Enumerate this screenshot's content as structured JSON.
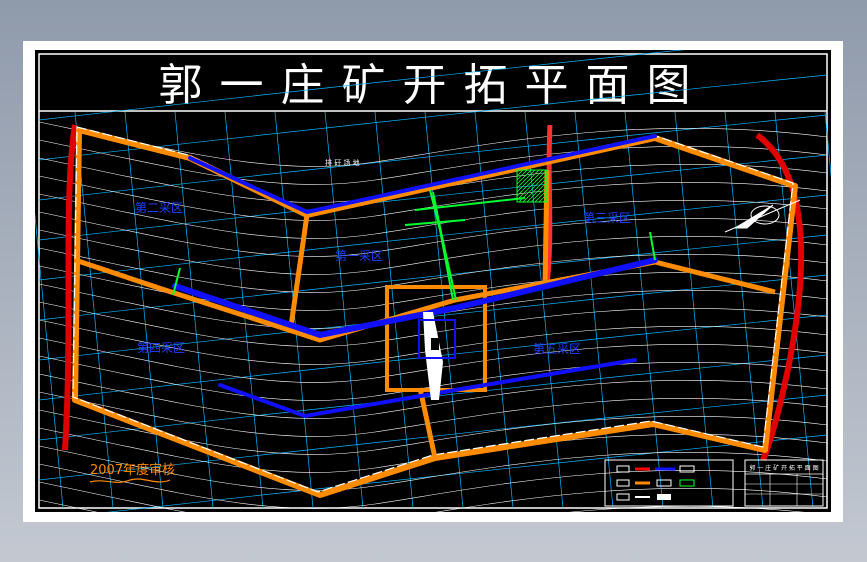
{
  "title": "郭一庄矿开拓平面图",
  "zones": {
    "zone1": "第一采区",
    "zone2": "第二采区",
    "zone3": "第三采区",
    "zone4": "第四采区",
    "zone5": "第五采区"
  },
  "road_label": "排 矸 场 地",
  "signature_label": "2007年度审核",
  "title_block": {
    "header": "郭 一 庄 矿 开 拓 平 面 图"
  },
  "colors": {
    "background": "#000000",
    "boundary": "#ff8c00",
    "roadway": "#1010ff",
    "fault": "#ff0000",
    "contour": "#ffffff",
    "grid": "#00b7ff",
    "shaft": "#00ff30"
  }
}
